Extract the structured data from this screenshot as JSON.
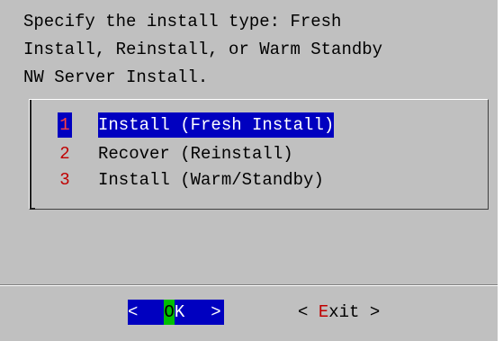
{
  "dialog": {
    "prompt_lines": [
      "Specify the install type: Fresh",
      "Install, Reinstall, or Warm Standby",
      "NW Server Install."
    ]
  },
  "menu": {
    "items": [
      {
        "num": "1",
        "label": "Install (Fresh Install)",
        "selected": true
      },
      {
        "num": "2",
        "label": "Recover (Reinstall)",
        "selected": false
      },
      {
        "num": "3",
        "label": "Install (Warm/Standby)",
        "selected": false
      }
    ]
  },
  "buttons": {
    "ok": {
      "open": "<",
      "hot": "O",
      "rest": "K",
      "close": ">"
    },
    "exit": {
      "open": "< ",
      "hot": "E",
      "rest": "xit",
      "close": " >"
    }
  },
  "colors": {
    "dialog_bg": "#c0c0c0",
    "highlight_bg": "#0000c0",
    "hotkey_red": "#c00000",
    "hotkey_green": "#00c000"
  }
}
